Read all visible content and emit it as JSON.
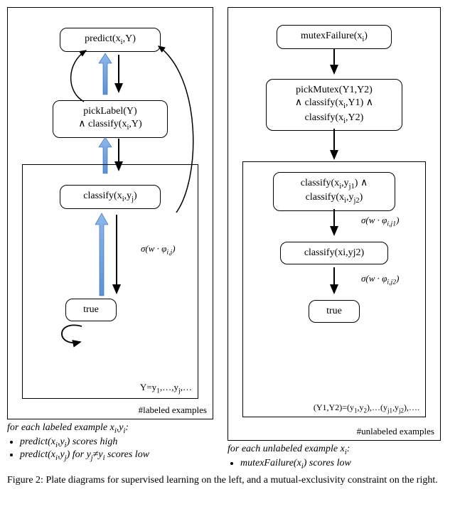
{
  "left": {
    "node1": "predict(x<sub>i</sub>,Y)",
    "node2": "pickLabel(Y)<br>∧ classify(x<sub>i</sub>,Y)",
    "node3": "classify(x<sub>i</sub>,y<sub>j</sub>)",
    "node4": "true",
    "edge34": "σ(w · φ<sub>i,j</sub>)",
    "inner_label": "Y=y<sub>1</sub>,…,y<sub>j</sub>,…",
    "outer_label": "#labeled examples",
    "desc_head": "for each labeled example x<sub>i</sub>,y<sub>i</sub>:",
    "bul1": "predict(x<sub>i</sub>,y<sub>i</sub>) scores high",
    "bul2": "predict(x<sub>i</sub>,y<sub>j</sub>) for y<sub>j</sub>≠y<sub>i</sub> scores low"
  },
  "right": {
    "node1": "mutexFailure(x<sub>i</sub>)",
    "node2": "pickMutex(Y1,Y2)<br>∧ classify(x<sub>i</sub>,Y1) ∧<br>classify(x<sub>i</sub>,Y2)",
    "node3": "classify(x<sub>i</sub>,y<sub>j1</sub>) ∧<br>classify(x<sub>i</sub>,y<sub>j2</sub>)",
    "node4": "classify(xi,yj2)",
    "node5": "true",
    "edge34": "σ(w · φ<sub>i,j1</sub>)",
    "edge45": "σ(w · φ<sub>i,j2</sub>)",
    "inner_label": "(Y1,Y2)=(y<sub>1</sub>,y<sub>2</sub>),…(y<sub>j1</sub>,y<sub>j2</sub>),….",
    "outer_label": "#unlabeled examples",
    "desc_head": "for each unlabeled example x<sub>i</sub>:",
    "bul1": "mutexFailure(x<sub>i</sub>) scores low"
  },
  "caption": "Figure 2: Plate diagrams for supervised learning on the left, and a mutual-exclusivity constraint on the right."
}
